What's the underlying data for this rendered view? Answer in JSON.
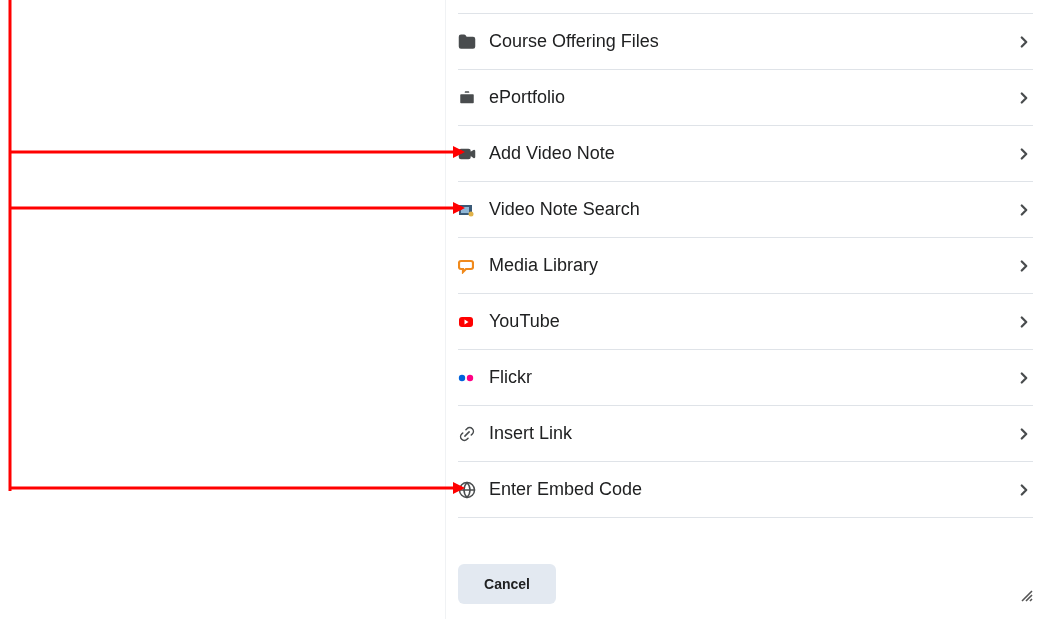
{
  "items": [
    {
      "kind": "folder",
      "label": "Course Offering Files",
      "pointed": false
    },
    {
      "kind": "portfolio",
      "label": "ePortfolio",
      "pointed": false
    },
    {
      "kind": "camera",
      "label": "Add Video Note",
      "pointed": true
    },
    {
      "kind": "videosearch",
      "label": "Video Note Search",
      "pointed": true
    },
    {
      "kind": "media",
      "label": "Media Library",
      "pointed": false
    },
    {
      "kind": "youtube",
      "label": "YouTube",
      "pointed": false
    },
    {
      "kind": "flickr",
      "label": "Flickr",
      "pointed": false
    },
    {
      "kind": "link",
      "label": "Insert Link",
      "pointed": false
    },
    {
      "kind": "globe",
      "label": "Enter Embed Code",
      "pointed": true
    }
  ],
  "cancel_button": "Cancel"
}
